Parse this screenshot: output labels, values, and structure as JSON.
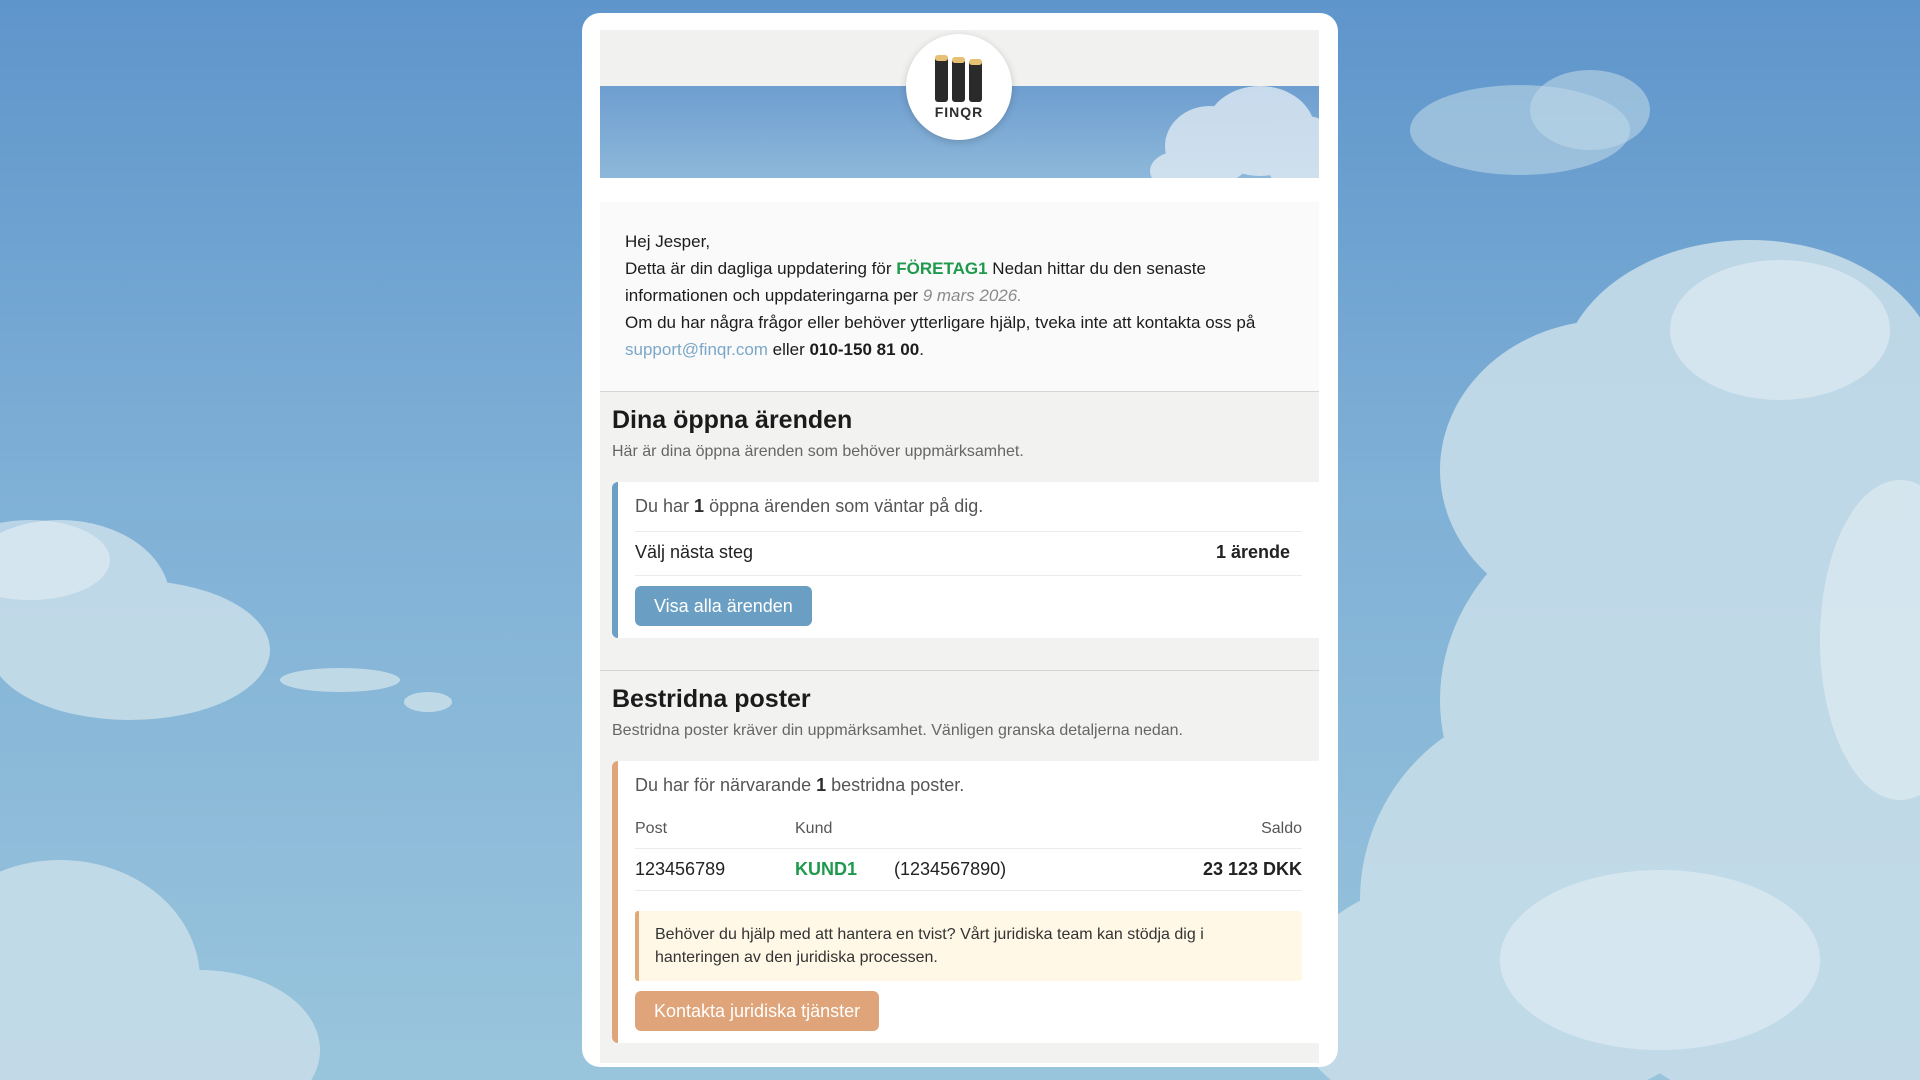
{
  "colors": {
    "accent_green": "#1f9a4c",
    "blue_button": "#6a9fc3",
    "orange_button": "#dfa47a",
    "link": "#7ba7c8"
  },
  "logo": {
    "text": "FINQR",
    "icon": "finqr-logo-icon"
  },
  "intro": {
    "greeting": "Hej Jesper,",
    "line1_pre": "Detta är din dagliga uppdatering för",
    "company": "FÖRETAG1",
    "line1_post": "Nedan hittar du den senaste informationen och uppdateringarna per",
    "date": "9 mars 2026.",
    "line2": "Om du har några frågor eller behöver ytterligare hjälp, tveka inte att kontakta oss på",
    "email": "support@finqr.com",
    "or": "eller",
    "phone": "010-150 81 00",
    "dot": "."
  },
  "open_cases": {
    "title": "Dina öppna ärenden",
    "subtitle": "Här är dina öppna ärenden som behöver uppmärksamhet.",
    "lead_pre": "Du har",
    "count": "1",
    "lead_post": "öppna ärenden som väntar på dig.",
    "step_label": "Välj nästa steg",
    "step_value": "1 ärende",
    "button": "Visa alla ärenden"
  },
  "disputed": {
    "title": "Bestridna poster",
    "subtitle": "Bestridna poster kräver din uppmärksamhet. Vänligen granska detaljerna nedan.",
    "lead_pre": "Du har för närvarande",
    "count": "1",
    "lead_post": "bestridna poster.",
    "columns": {
      "post": "Post",
      "kund": "Kund",
      "saldo": "Saldo"
    },
    "rows": [
      {
        "post": "123456789",
        "kund": "KUND1",
        "kund_id": "(1234567890)",
        "saldo": "23 123 DKK"
      }
    ],
    "note": "Behöver du hjälp med att hantera en tvist? Vårt juridiska team kan stödja dig i hanteringen av den juridiska processen.",
    "button": "Kontakta juridiska tjänster"
  }
}
